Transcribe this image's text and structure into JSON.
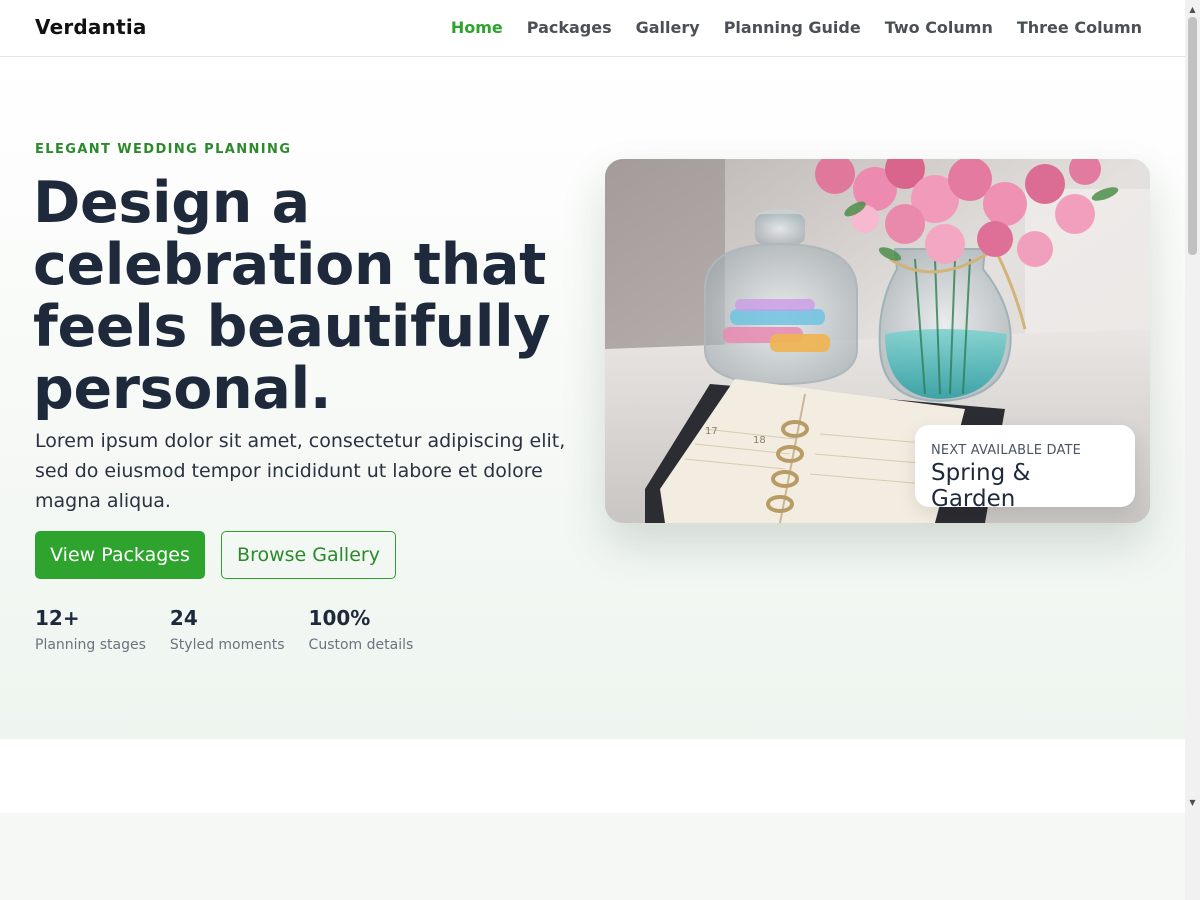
{
  "brand": "Verdantia",
  "nav": {
    "items": [
      "Home",
      "Packages",
      "Gallery",
      "Planning Guide",
      "Two Column",
      "Three Column"
    ],
    "active": "Home"
  },
  "hero": {
    "eyebrow": "ELEGANT WEDDING PLANNING",
    "headline": "Design a celebration that feels beautifully personal.",
    "lead": "Lorem ipsum dolor sit amet, consectetur adipiscing elit, sed do eiusmod tempor incididunt ut labore et dolore magna aliqua.",
    "primary_button": "View Packages",
    "secondary_button": "Browse Gallery",
    "stats": [
      {
        "value": "12+",
        "label": "Planning stages"
      },
      {
        "value": "24",
        "label": "Styled moments"
      },
      {
        "value": "100%",
        "label": "Custom details"
      }
    ]
  },
  "badge": {
    "caption": "NEXT AVAILABLE DATE",
    "value": "Spring & Garden"
  },
  "colors": {
    "accent": "#2ea32e",
    "accent_text": "#2b8a2b",
    "heading": "#1e293b"
  }
}
